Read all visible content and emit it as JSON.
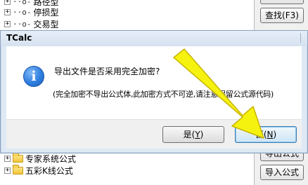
{
  "tree": {
    "items_top": [
      {
        "label": "路径型",
        "icon": "key-node-icon",
        "expander": "+"
      },
      {
        "label": "停损型",
        "icon": "key-node-icon",
        "expander": "+"
      },
      {
        "label": "交易型",
        "icon": "key-node-icon",
        "expander": "+"
      }
    ],
    "items_bottom": [
      {
        "label": "专家系统公式",
        "icon": "folder-icon",
        "expander": "+"
      },
      {
        "label": "五彩K线公式",
        "icon": "folder-icon",
        "expander": "+"
      }
    ]
  },
  "side_buttons": {
    "find": "查找(F3)",
    "export_partial": "导出公式",
    "import": "导入公式"
  },
  "dialog": {
    "title": "TCalc",
    "icon": "info-icon",
    "message": "导出文件是否采用完全加密?",
    "detail": "(完全加密不导出公式体,此加密方式不可逆,请注意保留公式源代码)",
    "yes": {
      "label": "是(",
      "key": "Y",
      "close": ")"
    },
    "no": {
      "label": "否(",
      "key": "N",
      "close": ")"
    }
  },
  "annotation": {
    "arrow_color": "#f5f20f",
    "arrow_outline": "#c9b400",
    "target": "no-button"
  }
}
